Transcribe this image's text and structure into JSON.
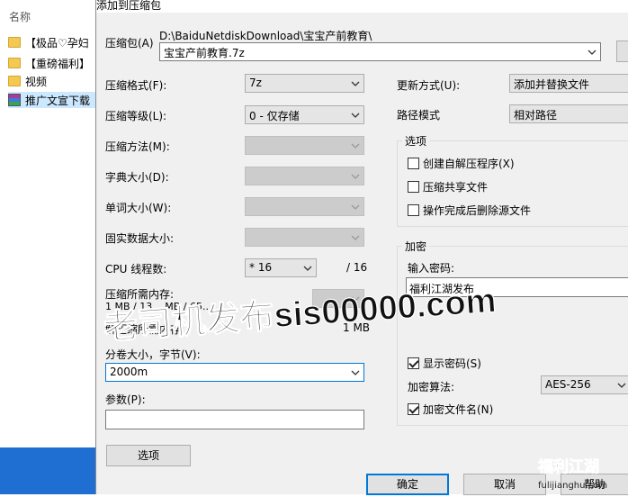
{
  "explorer": {
    "header": "名称",
    "items": [
      {
        "label": "【极品♡孕妇",
        "icon": "folder-icon"
      },
      {
        "label": "【重磅福利】",
        "icon": "folder-icon"
      },
      {
        "label": "视频",
        "icon": "folder-icon"
      },
      {
        "label": "推广文宣下载",
        "icon": "archive-icon"
      }
    ]
  },
  "dialog": {
    "title": "添加到压缩包",
    "archive": {
      "label": "压缩包(A)",
      "path": "D:\\BaiduNetdiskDownload\\宝宝产前教育\\",
      "filename": "宝宝产前教育.7z"
    },
    "left": {
      "format": {
        "label": "压缩格式(F):",
        "value": "7z"
      },
      "level": {
        "label": "压缩等级(L):",
        "value": "0 - 仅存储"
      },
      "method": {
        "label": "压缩方法(M):"
      },
      "dict": {
        "label": "字典大小(D):"
      },
      "word": {
        "label": "单词大小(W):"
      },
      "solid": {
        "label": "固实数据大小:"
      },
      "threads": {
        "label": "CPU 线程数:",
        "value": "* 16",
        "total": "/ 16"
      },
      "mem_compress": {
        "label": "压缩所需内存:",
        "value": "1 MB / 13... MB / 65..."
      },
      "mem_decompress": {
        "label": "解压缩所需内存:",
        "value": "1 MB"
      },
      "volume": {
        "label": "分卷大小，字节(V):",
        "value": "2000m"
      },
      "params": {
        "label": "参数(P):",
        "value": ""
      },
      "options_button": "选项"
    },
    "right": {
      "update": {
        "label": "更新方式(U):",
        "value": "添加并替换文件"
      },
      "path_mode": {
        "label": "路径模式",
        "value": "相对路径"
      },
      "options": {
        "title": "选项",
        "sfx": "创建自解压程序(X)",
        "shared": "压缩共享文件",
        "delete": "操作完成后删除源文件"
      },
      "encryption": {
        "title": "加密",
        "pwd_label": "输入密码:",
        "pwd_value": "福利江湖发布",
        "show_pwd": "显示密码(S)",
        "method_label": "加密算法:",
        "method_value": "AES-256",
        "encrypt_names": "加密文件名(N)"
      }
    },
    "buttons": {
      "ok": "确定",
      "cancel": "取消",
      "help": "帮助"
    }
  },
  "watermarks": {
    "overlay_text": "老司机发布sis00000.com",
    "logo_title": "福利江湖",
    "logo_url": "fulijianghu.com"
  }
}
